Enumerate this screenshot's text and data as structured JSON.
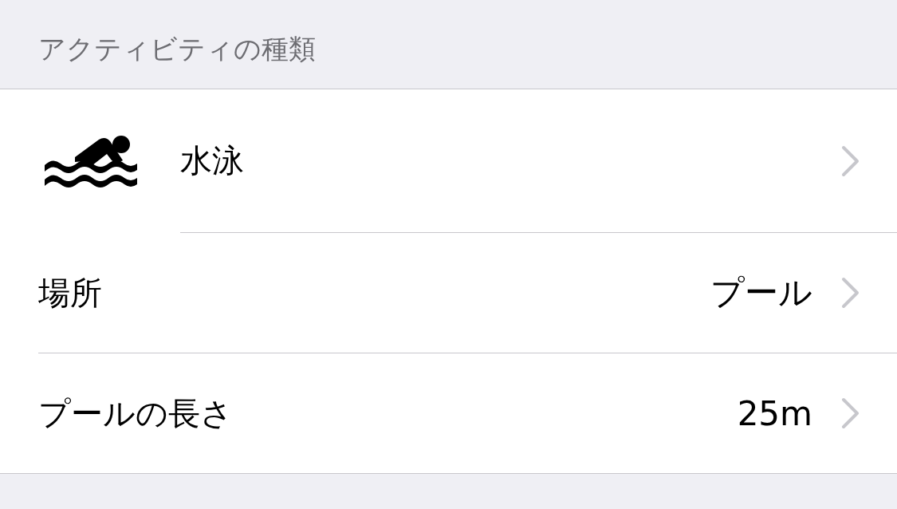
{
  "section_header": "アクティビティの種類",
  "rows": [
    {
      "kind": "activity",
      "label": "水泳"
    },
    {
      "kind": "detail",
      "label": "場所",
      "value": "プール"
    },
    {
      "kind": "detail",
      "label": "プールの長さ",
      "value": "25m"
    }
  ]
}
